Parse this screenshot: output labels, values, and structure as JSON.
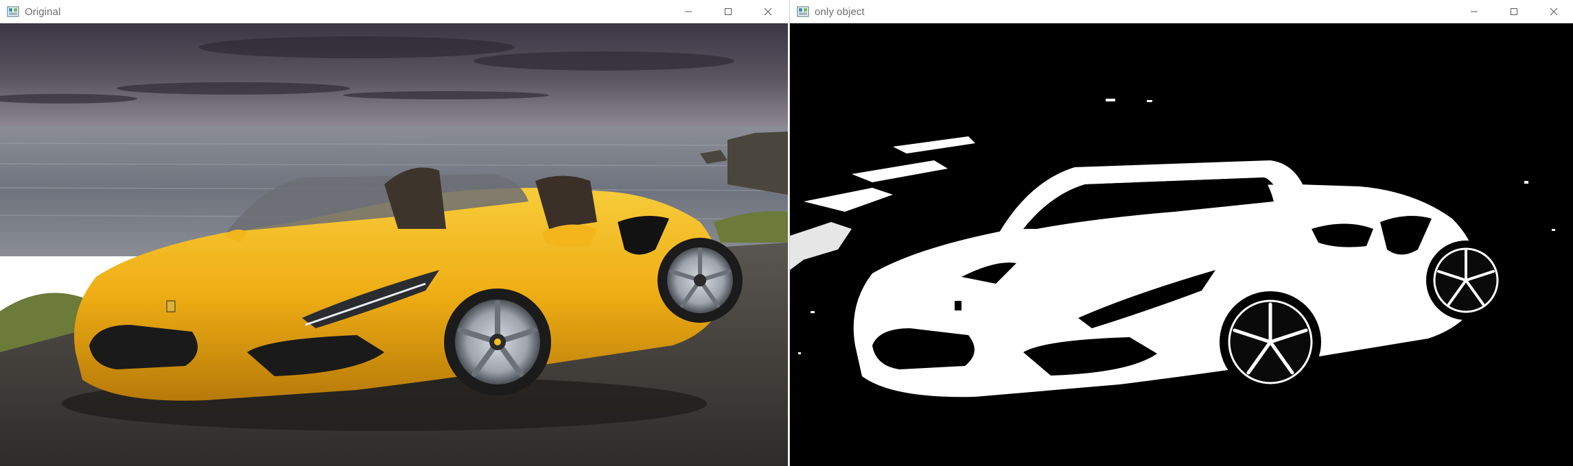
{
  "windows": [
    {
      "title": "Original"
    },
    {
      "title": "only object"
    }
  ],
  "controls": {
    "minimize": "minimize-icon",
    "maximize": "maximize-icon",
    "close": "close-icon"
  },
  "colors": {
    "car_yellow": "#f2b61c",
    "sky": "#3e3a48",
    "sea": "#6e7480",
    "road": "#3f3c38",
    "mask_bg": "#000000",
    "mask_fg": "#ffffff"
  }
}
